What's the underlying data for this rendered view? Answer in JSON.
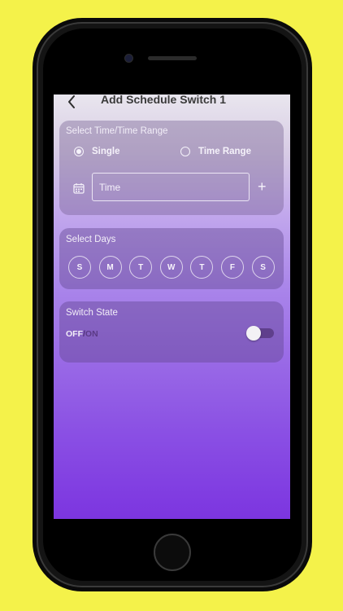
{
  "header": {
    "title": "Add Schedule Switch 1",
    "back_icon": "chevron-left-icon"
  },
  "time_card": {
    "title": "Select Time/Time Range",
    "options": [
      {
        "label": "Single",
        "selected": true
      },
      {
        "label": "Time Range",
        "selected": false
      }
    ],
    "time_placeholder": "Time",
    "calendar_icon": "calendar-icon",
    "add_icon": "plus-icon"
  },
  "days_card": {
    "title": "Select Days",
    "days": [
      "S",
      "M",
      "T",
      "W",
      "T",
      "F",
      "S"
    ]
  },
  "switch_card": {
    "title": "Switch State",
    "off_label": "OFF",
    "separator": "/",
    "on_label": "ON",
    "state": "off"
  },
  "colors": {
    "page_background": "#f4f24a",
    "gradient_top": "#e9e6ee",
    "gradient_bottom": "#7c35e0",
    "toggle_track": "#5f3f8c"
  }
}
